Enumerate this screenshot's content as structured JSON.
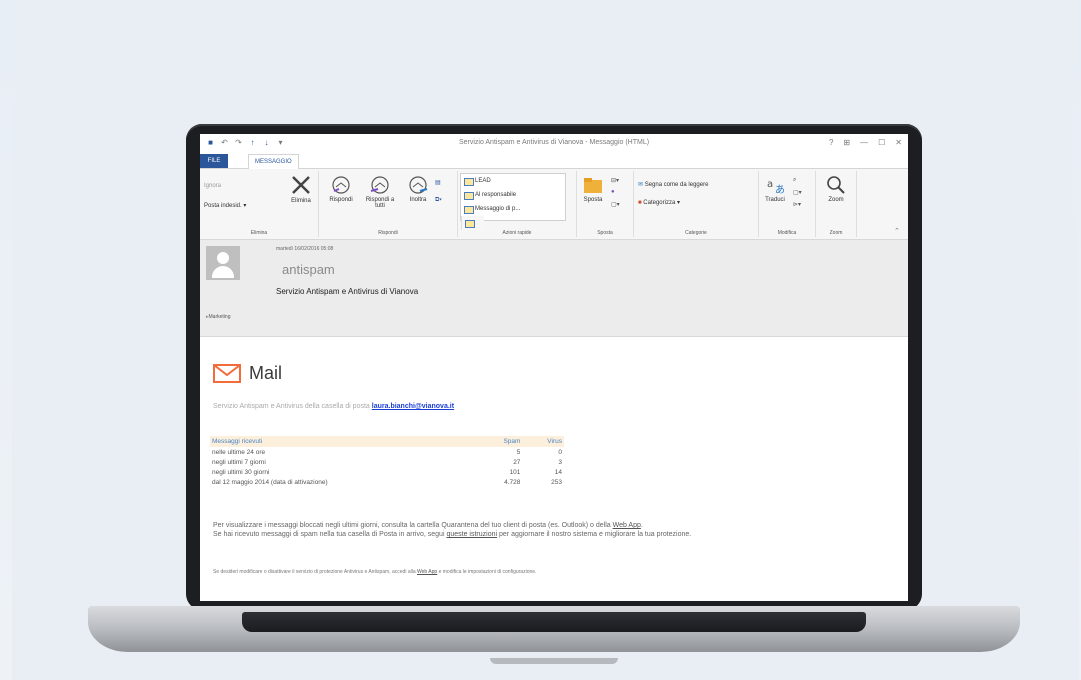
{
  "window": {
    "title": "Servizio Antispam e Antivirus di Vianova - Messaggio (HTML)",
    "controls": [
      "?",
      "⊞",
      "—",
      "☐",
      "✕"
    ]
  },
  "quick_access": [
    "💾",
    "↶",
    "↷",
    "↑",
    "↓",
    "▾"
  ],
  "tabs": [
    "FILE",
    "MESSAGGIO"
  ],
  "ribbon": {
    "elimina": {
      "ignora": "Ignora",
      "posta_indesid": "Posta indesid. ▾",
      "elimina": "Elimina",
      "label": "Elimina"
    },
    "rispondi": {
      "rispondi": "Rispondi",
      "rispondi_tutti": "Rispondi a tutti",
      "inoltra": "Inoltra",
      "label": "Rispondi"
    },
    "azioni_rapide": {
      "items": [
        "LEAD",
        "Al responsabile",
        "Messaggio di p..."
      ],
      "label": "Azioni rapide"
    },
    "sposta": {
      "sposta": "Sposta",
      "label": "Sposta"
    },
    "categorie": {
      "segna": "Segna come da leggere",
      "categorizza": "Categorizza ▾",
      "label": "Categorie"
    },
    "modifica": {
      "traduci": "Traduci",
      "label": "Modifica"
    },
    "zoom": {
      "zoom": "Zoom",
      "label": "Zoom"
    }
  },
  "message": {
    "date": "martedì 16/02/2016 05:08",
    "sender": "antispam",
    "subject": "Servizio Antispam e Antivirus di Vianova",
    "category": "Marketing"
  },
  "body": {
    "brand": "Mail",
    "intro_prefix": "Servizio Antispam e Antivirus della casella di posta",
    "email": "laura.bianchi@vianova.it",
    "table": {
      "headers": [
        "Messaggi ricevuti",
        "Spam",
        "Virus"
      ],
      "rows": [
        [
          "nelle ultime 24 ore",
          "5",
          "0"
        ],
        [
          "negli ultimi 7 giorni",
          "27",
          "3"
        ],
        [
          "negli ultimi 30 giorni",
          "101",
          "14"
        ],
        [
          "dal 12 maggio 2014 (data di attivazione)",
          "4.728",
          "253"
        ]
      ]
    },
    "para1_pre": "Per visualizzare i messaggi bloccati negli ultimi giorni, consulta la cartella Quarantena del tuo client di posta (es. Outlook) o della",
    "para1_link": "Web App",
    "para2_pre": "Se hai ricevuto messaggi di spam nella tua casella di Posta in arrivo, segui",
    "para2_link": "queste istruzioni",
    "para2_post": "per aggiornare il nostro sistema e migliorare la tua protezione.",
    "footnote_pre": "Se desideri modificare o disattivare il servizio di protezione Antivirus e Antispam, accedi alla",
    "footnote_link": "Web App",
    "footnote_post": "e modifica le impostazioni di configurazione."
  },
  "colors": {
    "accent": "#2b579a",
    "mail_orange": "#f26b3a",
    "link": "#1a3fd6"
  }
}
